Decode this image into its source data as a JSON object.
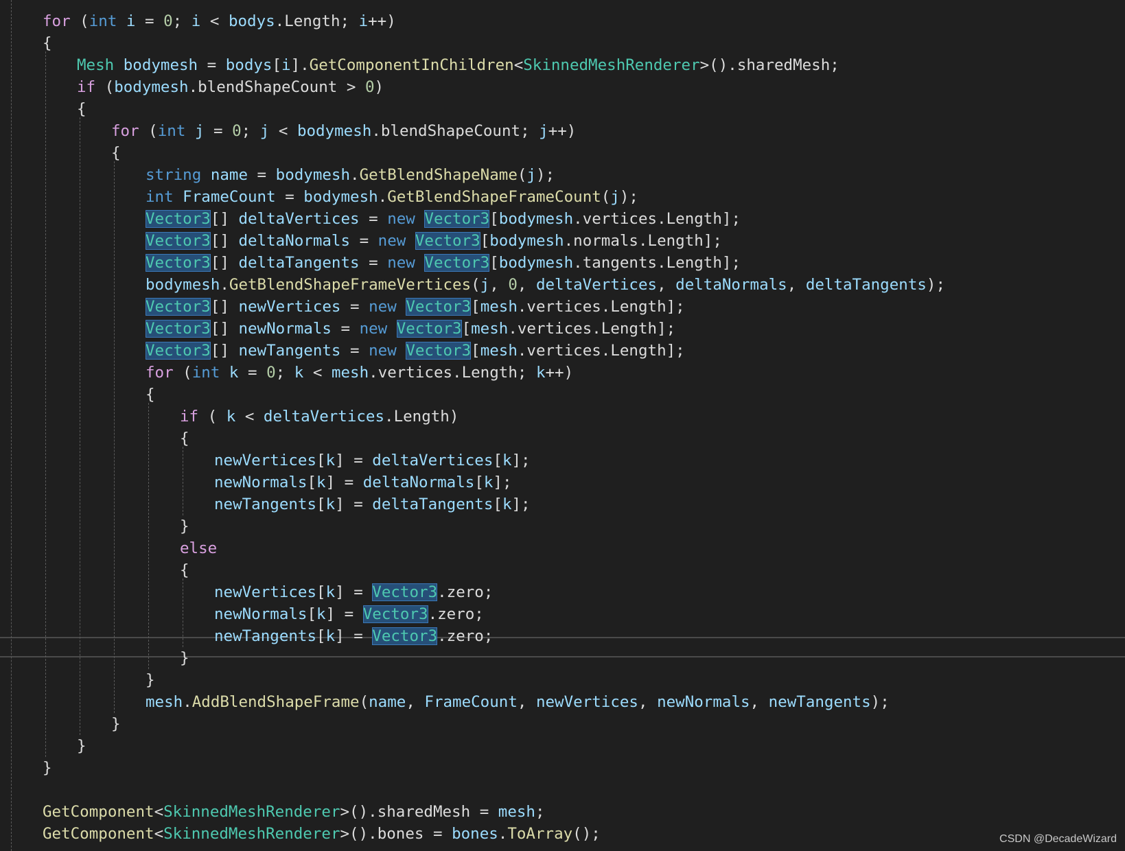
{
  "colors": {
    "background": "#1f1f1f",
    "control_keyword": "#d8a0df",
    "keyword": "#569cd6",
    "type": "#4ec9b0",
    "method": "#dcdcaa",
    "identifier": "#9cdcfe",
    "number": "#b5cea8",
    "plain": "#dcdcdc",
    "symbol_highlight": "#264f78"
  },
  "code": {
    "lines": [
      [
        [
          "kw-ctrl",
          "for"
        ],
        [
          "plain",
          " ("
        ],
        [
          "kw",
          "int"
        ],
        [
          "ident",
          " i"
        ],
        [
          "plain",
          " = "
        ],
        [
          "num",
          "0"
        ],
        [
          "plain",
          "; "
        ],
        [
          "ident",
          "i"
        ],
        [
          "plain",
          " < "
        ],
        [
          "ident",
          "bodys"
        ],
        [
          "plain",
          "."
        ],
        [
          "plain",
          "Length"
        ],
        [
          "plain",
          "; "
        ],
        [
          "ident",
          "i"
        ],
        [
          "plain",
          "++)"
        ]
      ],
      [
        [
          "plain",
          "{"
        ]
      ],
      [
        [
          "type",
          "Mesh"
        ],
        [
          "ident",
          " bodymesh"
        ],
        [
          "plain",
          " = "
        ],
        [
          "ident",
          "bodys"
        ],
        [
          "plain",
          "["
        ],
        [
          "ident",
          "i"
        ],
        [
          "plain",
          "]."
        ],
        [
          "method",
          "GetComponentInChildren"
        ],
        [
          "plain",
          "<"
        ],
        [
          "type",
          "SkinnedMeshRenderer"
        ],
        [
          "plain",
          ">()."
        ],
        [
          "plain",
          "sharedMesh;"
        ]
      ],
      [
        [
          "kw-ctrl",
          "if"
        ],
        [
          "plain",
          " ("
        ],
        [
          "ident",
          "bodymesh"
        ],
        [
          "plain",
          "."
        ],
        [
          "plain",
          "blendShapeCount"
        ],
        [
          "plain",
          " > "
        ],
        [
          "num",
          "0"
        ],
        [
          "plain",
          ")"
        ]
      ],
      [
        [
          "plain",
          "{"
        ]
      ],
      [
        [
          "kw-ctrl",
          "for"
        ],
        [
          "plain",
          " ("
        ],
        [
          "kw",
          "int"
        ],
        [
          "ident",
          " j"
        ],
        [
          "plain",
          " = "
        ],
        [
          "num",
          "0"
        ],
        [
          "plain",
          "; "
        ],
        [
          "ident",
          "j"
        ],
        [
          "plain",
          " < "
        ],
        [
          "ident",
          "bodymesh"
        ],
        [
          "plain",
          "."
        ],
        [
          "plain",
          "blendShapeCount"
        ],
        [
          "plain",
          "; "
        ],
        [
          "ident",
          "j"
        ],
        [
          "plain",
          "++)"
        ]
      ],
      [
        [
          "plain",
          "{"
        ]
      ],
      [
        [
          "kw",
          "string"
        ],
        [
          "ident",
          " name"
        ],
        [
          "plain",
          " = "
        ],
        [
          "ident",
          "bodymesh"
        ],
        [
          "plain",
          "."
        ],
        [
          "method",
          "GetBlendShapeName"
        ],
        [
          "plain",
          "("
        ],
        [
          "ident",
          "j"
        ],
        [
          "plain",
          ");"
        ]
      ],
      [
        [
          "kw",
          "int"
        ],
        [
          "ident",
          " FrameCount"
        ],
        [
          "plain",
          " = "
        ],
        [
          "ident",
          "bodymesh"
        ],
        [
          "plain",
          "."
        ],
        [
          "method",
          "GetBlendShapeFrameCount"
        ],
        [
          "plain",
          "("
        ],
        [
          "ident",
          "j"
        ],
        [
          "plain",
          ");"
        ]
      ],
      [
        [
          "hl",
          "Vector3"
        ],
        [
          "plain",
          "[] "
        ],
        [
          "ident",
          "deltaVertices"
        ],
        [
          "plain",
          " = "
        ],
        [
          "kw",
          "new"
        ],
        [
          "plain",
          " "
        ],
        [
          "hl",
          "Vector3"
        ],
        [
          "plain",
          "["
        ],
        [
          "ident",
          "bodymesh"
        ],
        [
          "plain",
          ".vertices.Length];"
        ]
      ],
      [
        [
          "hl",
          "Vector3"
        ],
        [
          "plain",
          "[] "
        ],
        [
          "ident",
          "deltaNormals"
        ],
        [
          "plain",
          " = "
        ],
        [
          "kw",
          "new"
        ],
        [
          "plain",
          " "
        ],
        [
          "hl",
          "Vector3"
        ],
        [
          "plain",
          "["
        ],
        [
          "ident",
          "bodymesh"
        ],
        [
          "plain",
          ".normals.Length];"
        ]
      ],
      [
        [
          "hl",
          "Vector3"
        ],
        [
          "plain",
          "[] "
        ],
        [
          "ident",
          "deltaTangents"
        ],
        [
          "plain",
          " = "
        ],
        [
          "kw",
          "new"
        ],
        [
          "plain",
          " "
        ],
        [
          "hl",
          "Vector3"
        ],
        [
          "plain",
          "["
        ],
        [
          "ident",
          "bodymesh"
        ],
        [
          "plain",
          ".tangents.Length];"
        ]
      ],
      [
        [
          "ident",
          "bodymesh"
        ],
        [
          "plain",
          "."
        ],
        [
          "method",
          "GetBlendShapeFrameVertices"
        ],
        [
          "plain",
          "("
        ],
        [
          "ident",
          "j"
        ],
        [
          "plain",
          ", "
        ],
        [
          "num",
          "0"
        ],
        [
          "plain",
          ", "
        ],
        [
          "ident",
          "deltaVertices"
        ],
        [
          "plain",
          ", "
        ],
        [
          "ident",
          "deltaNormals"
        ],
        [
          "plain",
          ", "
        ],
        [
          "ident",
          "deltaTangents"
        ],
        [
          "plain",
          ");"
        ]
      ],
      [
        [
          "hl",
          "Vector3"
        ],
        [
          "plain",
          "[] "
        ],
        [
          "ident",
          "newVertices"
        ],
        [
          "plain",
          " = "
        ],
        [
          "kw",
          "new"
        ],
        [
          "plain",
          " "
        ],
        [
          "hl",
          "Vector3"
        ],
        [
          "plain",
          "["
        ],
        [
          "ident",
          "mesh"
        ],
        [
          "plain",
          ".vertices.Length];"
        ]
      ],
      [
        [
          "hl",
          "Vector3"
        ],
        [
          "plain",
          "[] "
        ],
        [
          "ident",
          "newNormals"
        ],
        [
          "plain",
          " = "
        ],
        [
          "kw",
          "new"
        ],
        [
          "plain",
          " "
        ],
        [
          "hl",
          "Vector3"
        ],
        [
          "plain",
          "["
        ],
        [
          "ident",
          "mesh"
        ],
        [
          "plain",
          ".vertices.Length];"
        ]
      ],
      [
        [
          "hl",
          "Vector3"
        ],
        [
          "plain",
          "[] "
        ],
        [
          "ident",
          "newTangents"
        ],
        [
          "plain",
          " = "
        ],
        [
          "kw",
          "new"
        ],
        [
          "plain",
          " "
        ],
        [
          "hl",
          "Vector3"
        ],
        [
          "plain",
          "["
        ],
        [
          "ident",
          "mesh"
        ],
        [
          "plain",
          ".vertices.Length];"
        ]
      ],
      [
        [
          "kw-ctrl",
          "for"
        ],
        [
          "plain",
          " ("
        ],
        [
          "kw",
          "int"
        ],
        [
          "ident",
          " k"
        ],
        [
          "plain",
          " = "
        ],
        [
          "num",
          "0"
        ],
        [
          "plain",
          "; "
        ],
        [
          "ident",
          "k"
        ],
        [
          "plain",
          " < "
        ],
        [
          "ident",
          "mesh"
        ],
        [
          "plain",
          ".vertices.Length; "
        ],
        [
          "ident",
          "k"
        ],
        [
          "plain",
          "++)"
        ]
      ],
      [
        [
          "plain",
          "{"
        ]
      ],
      [
        [
          "kw-ctrl",
          "if"
        ],
        [
          "plain",
          " ( "
        ],
        [
          "ident",
          "k"
        ],
        [
          "plain",
          " < "
        ],
        [
          "ident",
          "deltaVertices"
        ],
        [
          "plain",
          ".Length)"
        ]
      ],
      [
        [
          "plain",
          "{"
        ]
      ],
      [
        [
          "ident",
          "newVertices"
        ],
        [
          "plain",
          "["
        ],
        [
          "ident",
          "k"
        ],
        [
          "plain",
          "] = "
        ],
        [
          "ident",
          "deltaVertices"
        ],
        [
          "plain",
          "["
        ],
        [
          "ident",
          "k"
        ],
        [
          "plain",
          "];"
        ]
      ],
      [
        [
          "ident",
          "newNormals"
        ],
        [
          "plain",
          "["
        ],
        [
          "ident",
          "k"
        ],
        [
          "plain",
          "] = "
        ],
        [
          "ident",
          "deltaNormals"
        ],
        [
          "plain",
          "["
        ],
        [
          "ident",
          "k"
        ],
        [
          "plain",
          "];"
        ]
      ],
      [
        [
          "ident",
          "newTangents"
        ],
        [
          "plain",
          "["
        ],
        [
          "ident",
          "k"
        ],
        [
          "plain",
          "] = "
        ],
        [
          "ident",
          "deltaTangents"
        ],
        [
          "plain",
          "["
        ],
        [
          "ident",
          "k"
        ],
        [
          "plain",
          "];"
        ]
      ],
      [
        [
          "plain",
          "}"
        ]
      ],
      [
        [
          "kw-ctrl",
          "else"
        ]
      ],
      [
        [
          "plain",
          "{"
        ]
      ],
      [
        [
          "ident",
          "newVertices"
        ],
        [
          "plain",
          "["
        ],
        [
          "ident",
          "k"
        ],
        [
          "plain",
          "] = "
        ],
        [
          "hl",
          "Vector3"
        ],
        [
          "plain",
          ".zero;"
        ]
      ],
      [
        [
          "ident",
          "newNormals"
        ],
        [
          "plain",
          "["
        ],
        [
          "ident",
          "k"
        ],
        [
          "plain",
          "] = "
        ],
        [
          "hl",
          "Vector3"
        ],
        [
          "plain",
          ".zero;"
        ]
      ],
      [
        [
          "ident",
          "newTangents"
        ],
        [
          "plain",
          "["
        ],
        [
          "ident",
          "k"
        ],
        [
          "plain",
          "] = "
        ],
        [
          "hl",
          "Vector3"
        ],
        [
          "plain",
          ".zero;"
        ]
      ],
      [
        [
          "plain",
          "}"
        ]
      ],
      [
        [
          "plain",
          "}"
        ]
      ],
      [
        [
          "ident",
          "mesh"
        ],
        [
          "plain",
          "."
        ],
        [
          "method",
          "AddBlendShapeFrame"
        ],
        [
          "plain",
          "("
        ],
        [
          "ident",
          "name"
        ],
        [
          "plain",
          ", "
        ],
        [
          "ident",
          "FrameCount"
        ],
        [
          "plain",
          ", "
        ],
        [
          "ident",
          "newVertices"
        ],
        [
          "plain",
          ", "
        ],
        [
          "ident",
          "newNormals"
        ],
        [
          "plain",
          ", "
        ],
        [
          "ident",
          "newTangents"
        ],
        [
          "plain",
          ");"
        ]
      ],
      [
        [
          "plain",
          "}"
        ]
      ],
      [
        [
          "plain",
          "}"
        ]
      ],
      [
        [
          "plain",
          "}"
        ]
      ],
      [
        [
          "plain",
          ""
        ]
      ],
      [
        [
          "method",
          "GetComponent"
        ],
        [
          "plain",
          "<"
        ],
        [
          "type",
          "SkinnedMeshRenderer"
        ],
        [
          "plain",
          ">()."
        ],
        [
          "plain",
          "sharedMesh = "
        ],
        [
          "ident",
          "mesh"
        ],
        [
          "plain",
          ";"
        ]
      ],
      [
        [
          "method",
          "GetComponent"
        ],
        [
          "plain",
          "<"
        ],
        [
          "type",
          "SkinnedMeshRenderer"
        ],
        [
          "plain",
          ">()."
        ],
        [
          "plain",
          "bones = "
        ],
        [
          "ident",
          "bones"
        ],
        [
          "plain",
          "."
        ],
        [
          "method",
          "ToArray"
        ],
        [
          "plain",
          "();"
        ]
      ]
    ],
    "indents": [
      0,
      0,
      1,
      1,
      1,
      2,
      2,
      3,
      3,
      3,
      3,
      3,
      3,
      3,
      3,
      3,
      3,
      3,
      4,
      4,
      5,
      5,
      5,
      4,
      4,
      4,
      5,
      5,
      5,
      4,
      3,
      3,
      2,
      1,
      0,
      0,
      0,
      0
    ]
  },
  "watermark": "CSDN @DecadeWizard"
}
